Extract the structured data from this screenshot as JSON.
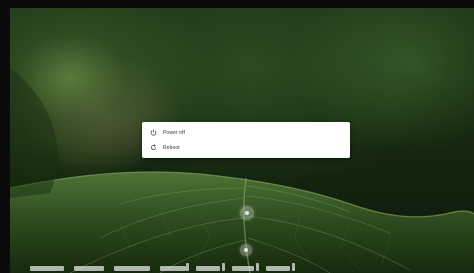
{
  "power_menu": {
    "items": [
      {
        "label": "Power off",
        "icon": "power-icon"
      },
      {
        "label": "Reboot",
        "icon": "reboot-icon"
      }
    ]
  },
  "colors": {
    "menu_background": "#ffffff",
    "menu_text": "#333333",
    "icon": "#555555",
    "wallpaper_dark": "#0d1a0a",
    "wallpaper_leaf": "#3b5a2a"
  }
}
